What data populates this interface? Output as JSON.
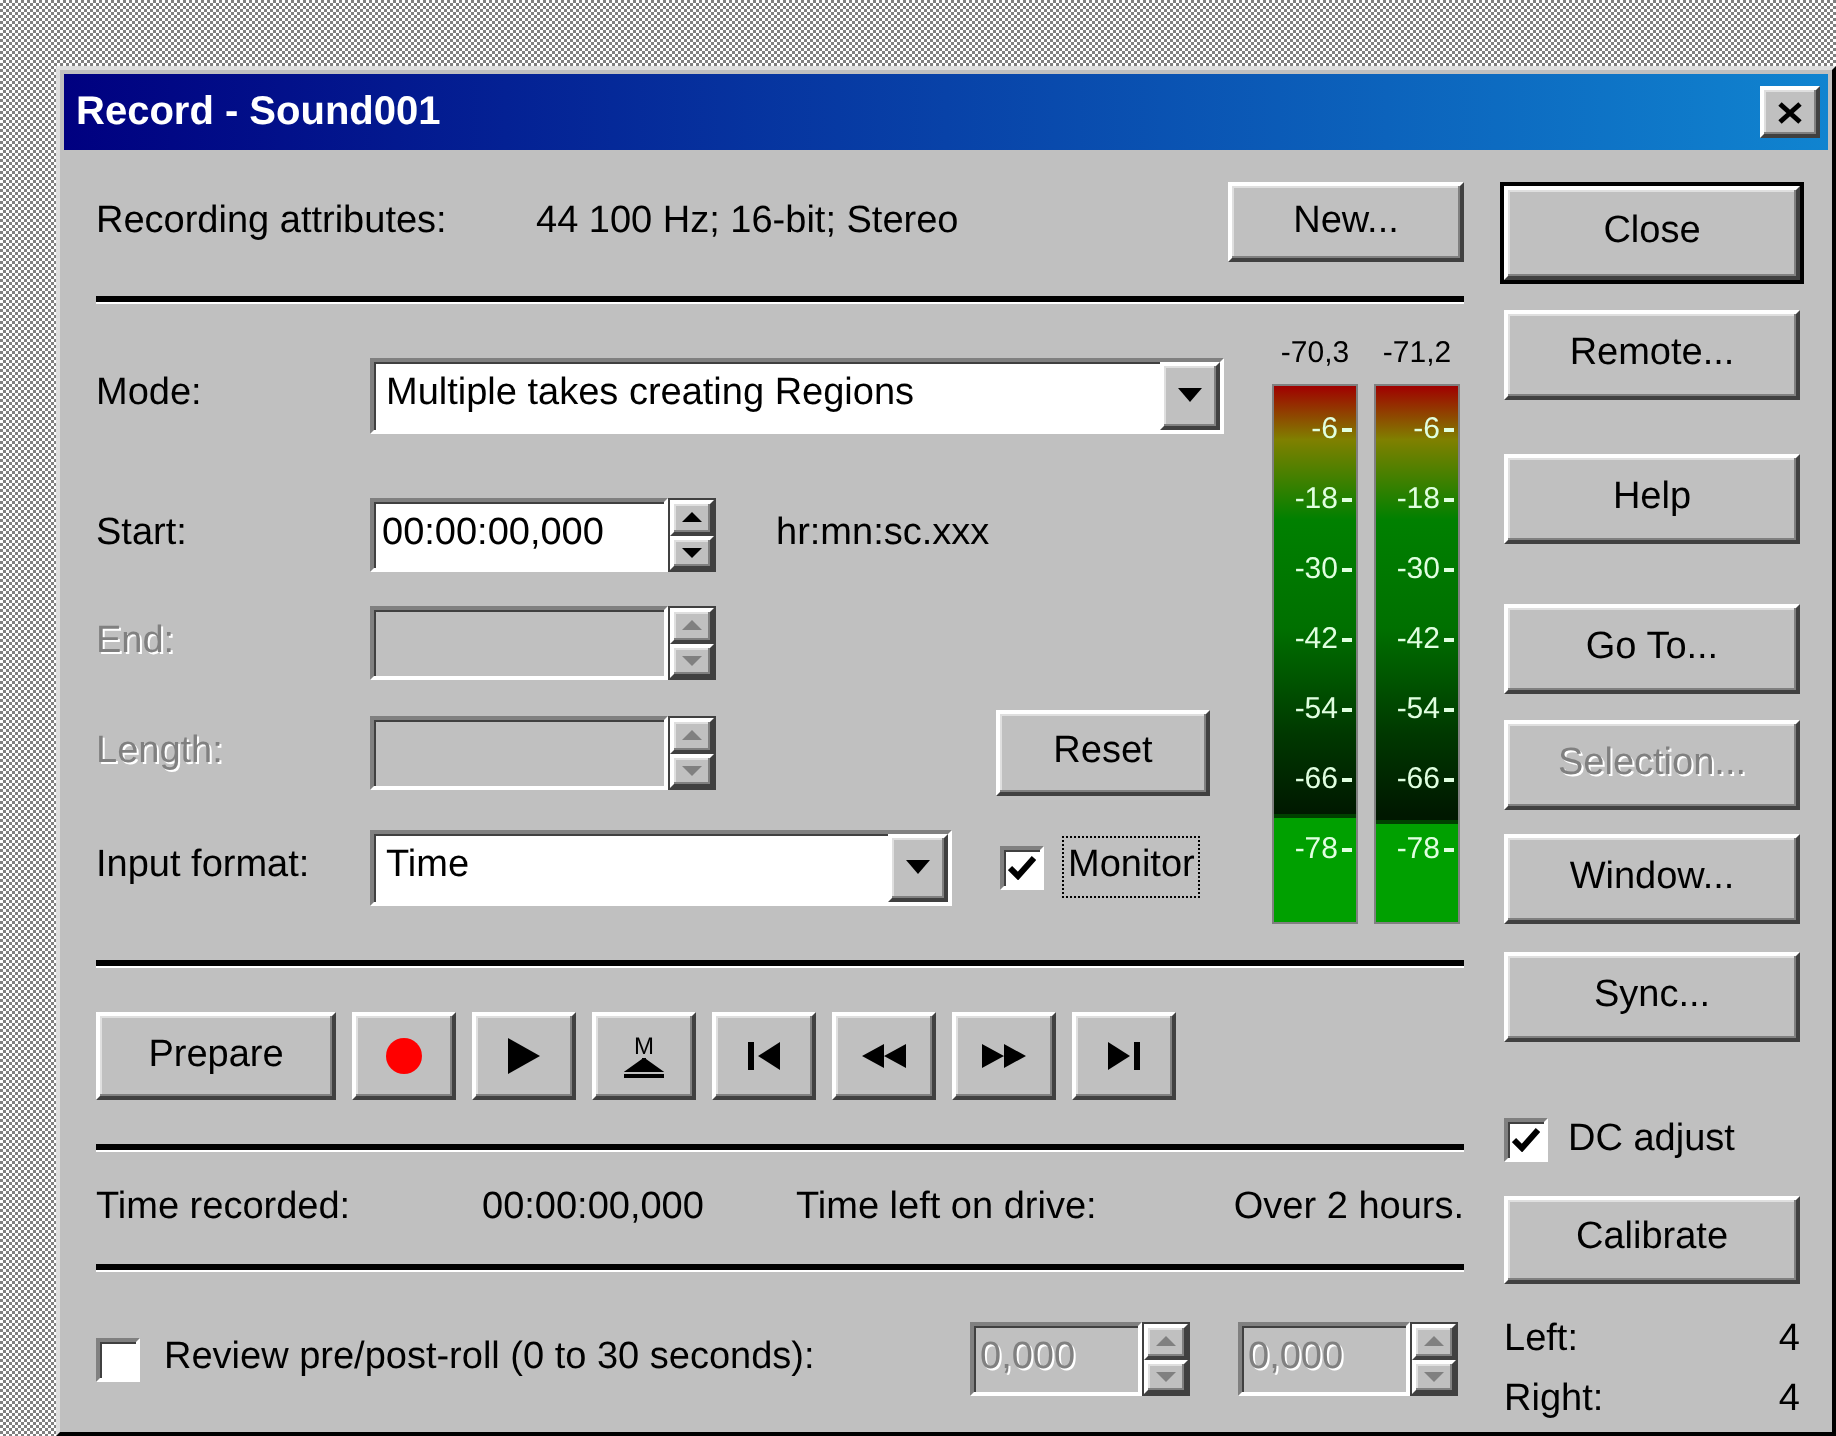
{
  "window": {
    "title": "Record - Sound001"
  },
  "attributes": {
    "label": "Recording attributes:",
    "value": "44 100 Hz; 16-bit; Stereo"
  },
  "new_button": {
    "label": "New..."
  },
  "fields": [
    {
      "kind": "combo",
      "label": "Mode:",
      "value": "Multiple takes creating Regions",
      "disabled": false
    },
    {
      "kind": "spin",
      "label": "Start:",
      "value": "00:00:00,000",
      "hint": "hr:mn:sc.xxx",
      "disabled": false
    },
    {
      "kind": "spin",
      "label": "End:",
      "disabled": true
    },
    {
      "kind": "spin",
      "label": "Length:",
      "disabled": true
    },
    {
      "kind": "combo",
      "label": "Input format:",
      "value": "Time",
      "disabled": false
    }
  ],
  "reset_button": {
    "label": "Reset"
  },
  "monitor": {
    "label": "Monitor",
    "checked": true,
    "focused": true
  },
  "meters": [
    {
      "reading": "-70,3",
      "level": 0.2,
      "scale": [
        "-6",
        "-18",
        "-30",
        "-42",
        "-54",
        "-66",
        "-78"
      ]
    },
    {
      "reading": "-71,2",
      "level": 0.19,
      "scale": [
        "-6",
        "-18",
        "-30",
        "-42",
        "-54",
        "-66",
        "-78"
      ]
    }
  ],
  "transport": [
    {
      "kind": "text",
      "label": "Prepare"
    },
    {
      "kind": "record"
    },
    {
      "kind": "play"
    },
    {
      "kind": "marker",
      "label": "M"
    },
    {
      "kind": "start"
    },
    {
      "kind": "rewind"
    },
    {
      "kind": "forward"
    },
    {
      "kind": "end"
    }
  ],
  "status": {
    "recorded_label": "Time recorded:",
    "recorded": "00:00:00,000",
    "left_label": "Time left on drive:",
    "left": "Over 2 hours."
  },
  "review": {
    "label": "Review pre/post-roll (0 to 30 seconds):",
    "checked": false,
    "pre": "0,000",
    "post": "0,000",
    "disabled": true
  },
  "side_buttons": [
    {
      "label": "Close",
      "default": true,
      "disabled": false
    },
    {
      "label": "Remote...",
      "default": false,
      "disabled": false
    },
    {
      "label": "Help",
      "default": false,
      "disabled": false
    },
    {
      "label": "Go To...",
      "default": false,
      "disabled": false
    },
    {
      "label": "Selection...",
      "default": false,
      "disabled": true
    },
    {
      "label": "Window...",
      "default": false,
      "disabled": false
    },
    {
      "label": "Sync...",
      "default": false,
      "disabled": false
    }
  ],
  "dc_adjust": {
    "label": "DC adjust",
    "checked": true
  },
  "calibrate_button": {
    "label": "Calibrate"
  },
  "dc_offsets": [
    {
      "label": "Left:",
      "value": "4"
    },
    {
      "label": "Right:",
      "value": "4"
    }
  ]
}
